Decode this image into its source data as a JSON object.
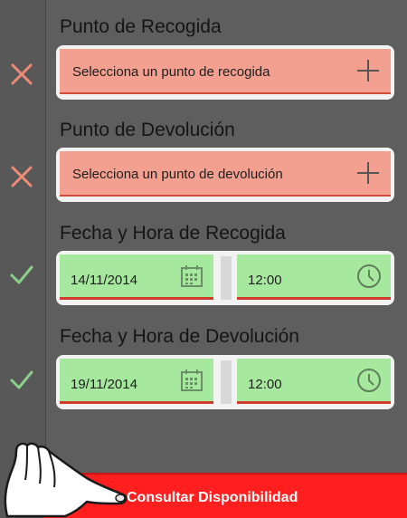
{
  "sections": [
    {
      "title": "Punto de Recogida",
      "status": "invalid",
      "field_text": "Selecciona un punto de recogida"
    },
    {
      "title": "Punto de Devolución",
      "status": "invalid",
      "field_text": "Selecciona un punto de devolución"
    },
    {
      "title": "Fecha y Hora de Recogida",
      "status": "valid",
      "date": "14/11/2014",
      "time": "12:00"
    },
    {
      "title": "Fecha y Hora de Devolución",
      "status": "valid",
      "date": "19/11/2014",
      "time": "12:00"
    }
  ],
  "cta": {
    "label": "Consultar Disponibilidad"
  },
  "icons": {
    "invalid": "x-icon",
    "valid": "check-icon",
    "add": "plus-icon",
    "calendar": "calendar-icon",
    "clock": "clock-icon",
    "hand": "pointing-hand-icon"
  },
  "colors": {
    "background": "#5a5a5a",
    "invalid_field": "#f3a090",
    "invalid_x": "#f08b78",
    "valid_field": "#a6e89e",
    "valid_check": "#8ad08a",
    "underline": "#d23b2b",
    "cta": "#ff1f1f"
  }
}
